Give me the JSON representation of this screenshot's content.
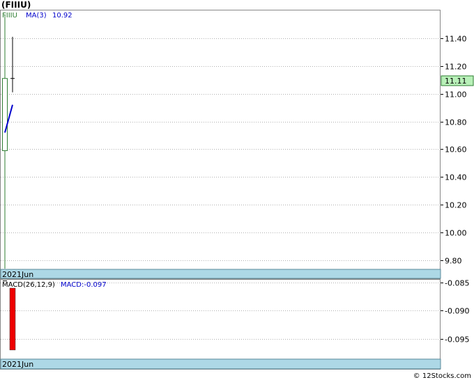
{
  "page": {
    "title": "(FIIIU)",
    "watermark": "© 12Stocks.com"
  },
  "chart_data": [
    {
      "type": "candlestick",
      "panel": "price",
      "ticker_label": "FIIIU",
      "ma_label": "MA(3)",
      "ma_value": "10.92",
      "last_price_label": "11.11",
      "last_price": 11.11,
      "date_label": "2021Jun",
      "ylim": [
        9.74,
        11.6
      ],
      "yticks": [
        9.8,
        10.0,
        10.2,
        10.4,
        10.6,
        10.8,
        11.0,
        11.2,
        11.4
      ],
      "ytick_labels": [
        "9.80",
        "10.00",
        "10.20",
        "10.40",
        "10.60",
        "10.80",
        "11.00",
        "11.20",
        "11.40"
      ],
      "candles": [
        {
          "index": 0,
          "open": 10.59,
          "close": 11.11,
          "high": 11.57,
          "low": 9.74,
          "color": "#2e7d32"
        },
        {
          "index": 1,
          "open": 11.11,
          "close": 11.11,
          "high": 11.41,
          "low": 11.01,
          "color": "#000000"
        }
      ],
      "ma_series": [
        {
          "index": 0,
          "value": 10.72
        },
        {
          "index": 1,
          "value": 10.92
        }
      ],
      "colors": {
        "ma": "#0000cc",
        "up_candle": "#2e7d32",
        "ticker": "#2e7d32",
        "last_price_bg": "#b8f0b8",
        "date_bar": "#add8e6",
        "grid": "#b0b0b0"
      }
    },
    {
      "type": "bar",
      "panel": "macd",
      "label": "MACD(26,12,9)",
      "macd_text": "MACD:-0.097",
      "date_label": "2021Jun",
      "ylim": [
        -0.0985,
        -0.0845
      ],
      "yticks": [
        -0.085,
        -0.09,
        -0.095
      ],
      "ytick_labels": [
        "-0.085",
        "-0.090",
        "-0.095"
      ],
      "bars": [
        {
          "index": 1,
          "value": -0.097,
          "color": "#ee0000"
        }
      ],
      "signal_marks": [
        {
          "index": 0,
          "value": -0.0847
        }
      ],
      "colors": {
        "label": "#000000",
        "macd_text": "#0000cc",
        "bar": "#ee0000"
      }
    }
  ]
}
